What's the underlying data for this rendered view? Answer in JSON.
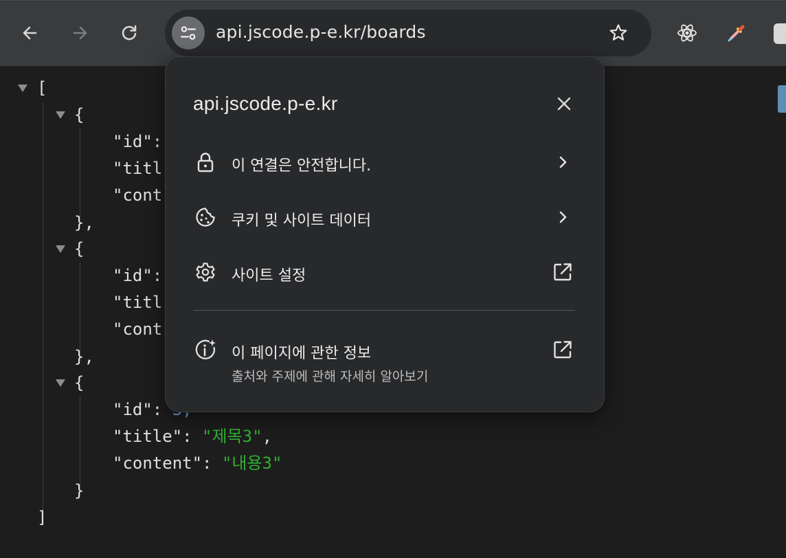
{
  "toolbar": {
    "url": "api.jscode.p-e.kr/boards",
    "icons": {
      "back": "back-arrow-icon",
      "forward": "forward-arrow-icon",
      "reload": "reload-icon",
      "site_info": "tune-icon",
      "bookmark": "star-icon",
      "ext1": "react-icon",
      "ext2": "eyedropper-icon"
    }
  },
  "json_view": {
    "open_bracket": "[",
    "close_bracket": "]",
    "open_brace": "{",
    "close_brace_comma": "},",
    "close_brace": "}",
    "items": [
      {
        "id_key": "\"id\":",
        "title_key": "\"titl",
        "content_key": "\"cont"
      },
      {
        "id_key": "\"id\":",
        "title_key": "\"titl",
        "content_key": "\"cont"
      },
      {
        "id_key": "\"id\":",
        "id_value": "3,",
        "title_key": "\"title\":",
        "title_value": "\"제목3\"",
        "title_comma": ",",
        "content_key": "\"content\":",
        "content_value": "\"내용3\""
      }
    ]
  },
  "popup": {
    "title": "api.jscode.p-e.kr",
    "items": [
      {
        "label": "이 연결은 안전합니다.",
        "icon": "lock-icon",
        "trail": "chevron-right-icon"
      },
      {
        "label": "쿠키 및 사이트 데이터",
        "icon": "cookie-icon",
        "trail": "chevron-right-icon"
      },
      {
        "label": "사이트 설정",
        "icon": "gear-icon",
        "trail": "open-external-icon"
      },
      {
        "label": "이 페이지에 관한 정보",
        "sublabel": "출처와 주제에 관해 자세히 알아보기",
        "icon": "info-sparkle-icon",
        "trail": "open-external-icon"
      }
    ]
  },
  "colors": {
    "toolbar_bg": "#3a3b3d",
    "omnibox_bg": "#28292b",
    "page_bg": "#1d1d1e",
    "popup_bg": "#28292b",
    "string": "#2fb12f",
    "number": "#6aa7e6"
  }
}
